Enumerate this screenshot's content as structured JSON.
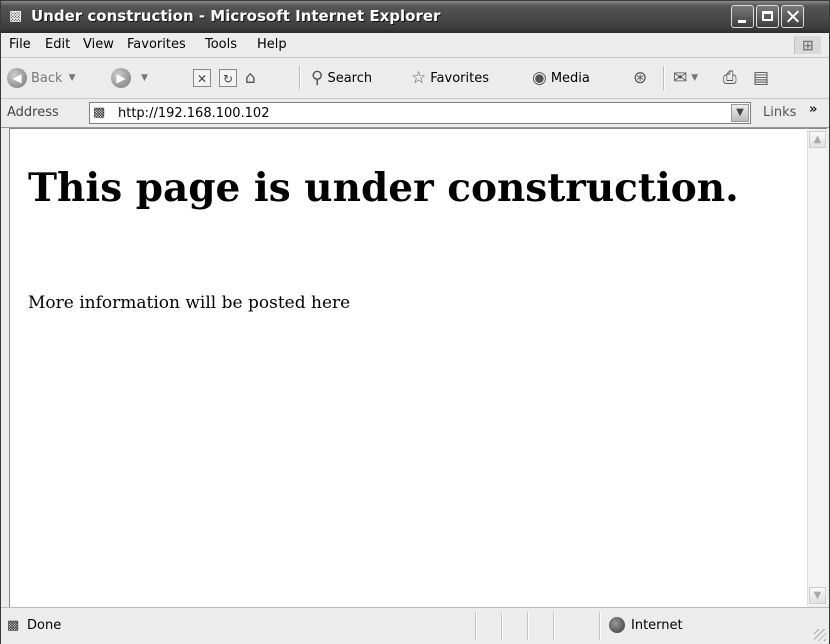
{
  "window": {
    "title": "Under construction - Microsoft Internet Explorer",
    "title_icon": "ie-page-icon"
  },
  "menu": {
    "items": [
      "File",
      "Edit",
      "View",
      "Favorites",
      "Tools",
      "Help"
    ]
  },
  "toolbar": {
    "back_label": "Back",
    "search_label": "Search",
    "favorites_label": "Favorites",
    "media_label": "Media"
  },
  "address": {
    "label": "Address",
    "url": "http://192.168.100.102",
    "links_label": "Links",
    "links_chevron": "»"
  },
  "page": {
    "heading": "This page is under construction.",
    "paragraph": "More information will be posted here"
  },
  "status": {
    "text": "Done",
    "zone": "Internet"
  }
}
